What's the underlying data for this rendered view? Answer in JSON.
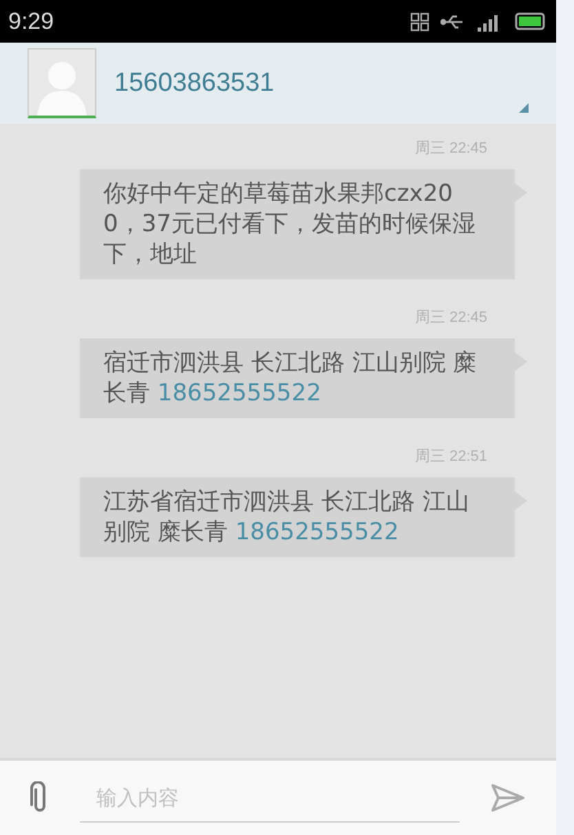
{
  "status_bar": {
    "time": "9:29"
  },
  "header": {
    "contact": "15603863531"
  },
  "messages": [
    {
      "time": "周三 22:45",
      "parts": [
        {
          "kind": "plain",
          "text": "你好中午定的草莓苗水果邦czx200，37元已付看下，发苗的时候保湿下，地址"
        }
      ]
    },
    {
      "time": "周三 22:45",
      "parts": [
        {
          "kind": "plain",
          "text": "宿迁市泗洪县 长江北路 江山别院 糜长青 "
        },
        {
          "kind": "phone",
          "text": "18652555522"
        }
      ]
    },
    {
      "time": "周三 22:51",
      "parts": [
        {
          "kind": "plain",
          "text": "江苏省宿迁市泗洪县 长江北路 江山别院  糜长青 "
        },
        {
          "kind": "phone",
          "text": "18652555522"
        }
      ]
    }
  ],
  "composer": {
    "placeholder": "输入内容"
  }
}
